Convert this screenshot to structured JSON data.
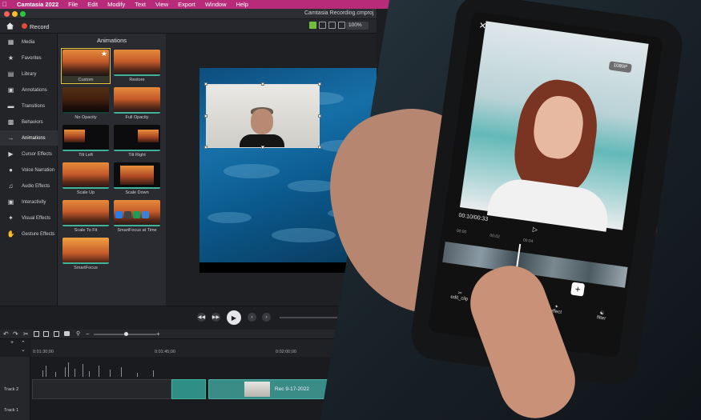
{
  "menubar": {
    "app": "Camtasia 2022",
    "items": [
      "File",
      "Edit",
      "Modify",
      "Text",
      "View",
      "Export",
      "Window",
      "Help"
    ]
  },
  "window": {
    "title": "Camtasia Recording.cmproj"
  },
  "toolbar": {
    "record_label": "Record",
    "zoom": "100%"
  },
  "sidebar": {
    "items": [
      {
        "label": "Media",
        "icon": "media-icon"
      },
      {
        "label": "Favorites",
        "icon": "star-icon"
      },
      {
        "label": "Library",
        "icon": "library-icon"
      },
      {
        "label": "Annotations",
        "icon": "annotations-icon"
      },
      {
        "label": "Transitions",
        "icon": "transitions-icon"
      },
      {
        "label": "Behaviors",
        "icon": "behaviors-icon"
      },
      {
        "label": "Animations",
        "icon": "animations-icon"
      },
      {
        "label": "Cursor Effects",
        "icon": "cursor-icon"
      },
      {
        "label": "Voice Narration",
        "icon": "microphone-icon"
      },
      {
        "label": "Audio Effects",
        "icon": "audio-icon"
      },
      {
        "label": "Interactivity",
        "icon": "interactivity-icon"
      },
      {
        "label": "Visual Effects",
        "icon": "visual-effects-icon"
      },
      {
        "label": "Gesture Effects",
        "icon": "gesture-icon"
      }
    ]
  },
  "animations": {
    "title": "Animations",
    "items": [
      "Custom",
      "Restore",
      "No Opacity",
      "Full Opacity",
      "Tilt Left",
      "Tilt Right",
      "Scale Up",
      "Scale Down",
      "Scale To Fit",
      "SmartFocus at Time",
      "SmartFocus"
    ]
  },
  "timeline": {
    "ticks": [
      "0:01:30;00",
      "0:01:45;00",
      "0:02:00;00"
    ],
    "tracks": [
      "Track 2",
      "Track 1"
    ],
    "clip_label": "Rec 9-17-2022"
  },
  "phone": {
    "resolution": "1080P",
    "time": "00:10/00:33",
    "ruler": [
      "00:00",
      "00:02",
      "00:04"
    ],
    "tools": [
      "edit_clip",
      "audio",
      "effect",
      "filter"
    ]
  },
  "colors": {
    "menubar": "#b72b79",
    "accent_green": "#6fbf3a",
    "clip_teal": "#3a8c86",
    "selected_outline": "#e9c53a",
    "record_red": "#e24a3b"
  }
}
